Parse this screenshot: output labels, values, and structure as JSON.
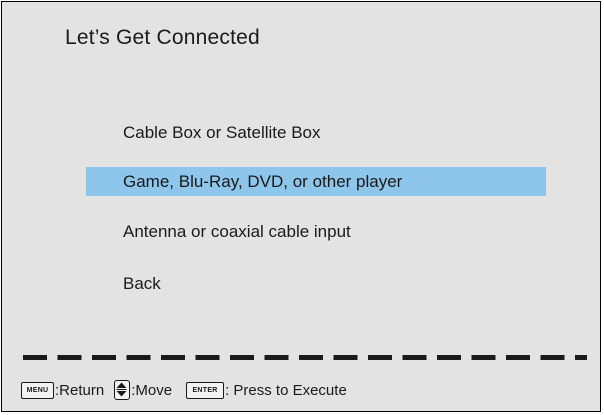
{
  "title": "Let’s Get Connected",
  "menu": {
    "items": [
      {
        "label": "Cable Box or Satellite Box",
        "selected": false
      },
      {
        "label": "Game, Blu-Ray, DVD, or other player",
        "selected": true
      },
      {
        "label": "Antenna or coaxial cable input",
        "selected": false
      },
      {
        "label": "Back",
        "selected": false
      }
    ]
  },
  "hints": {
    "menu_key": "MENU",
    "menu_text": ":Return",
    "move_icon": "up-down-arrow-icon",
    "move_text": ":Move",
    "enter_key": "ENTER",
    "enter_text": ": Press to Execute"
  },
  "colors": {
    "background": "#e3e3e3",
    "highlight": "#8ec5eb",
    "text": "#1a1a1a"
  }
}
